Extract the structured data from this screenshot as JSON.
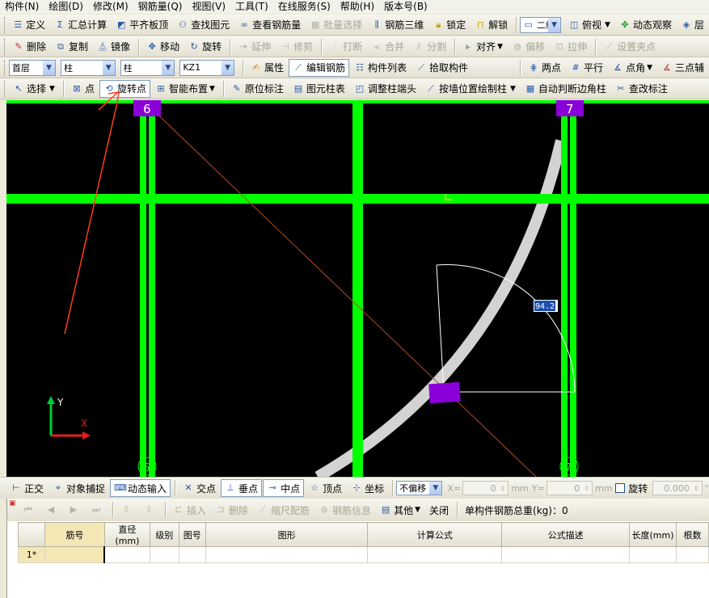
{
  "menu": [
    "构件(N)",
    "绘图(D)",
    "修改(M)",
    "钢筋量(Q)",
    "视图(V)",
    "工具(T)",
    "在线服务(S)",
    "帮助(H)",
    "版本号(B)"
  ],
  "toolbar1": {
    "define": "定义",
    "sum_calc": "汇总计算",
    "flush_slab": "平齐板顶",
    "find_element": "查找图元",
    "view_rebar_qty": "查看钢筋量",
    "batch_select": "批量选择",
    "rebar_3d": "钢筋三维",
    "lock": "锁定",
    "unlock": "解锁",
    "view_mode": "二维",
    "top_view": "俯视",
    "dynamic_observe": "动态观察",
    "layer": "层"
  },
  "toolbar2": {
    "delete": "删除",
    "copy": "复制",
    "mirror": "镜像",
    "move": "移动",
    "rotate": "旋转",
    "extend": "延伸",
    "trim": "修剪",
    "break": "打断",
    "merge": "合并",
    "split": "分割",
    "align": "对齐",
    "offset": "偏移",
    "stretch": "拉伸",
    "set_grip": "设置夹点"
  },
  "toolbar3": {
    "floor": "首层",
    "category": "柱",
    "type": "柱",
    "element": "KZ1",
    "properties": "属性",
    "edit_rebar": "编辑钢筋",
    "element_list": "构件列表",
    "pick_element": "拾取构件",
    "two_points": "两点",
    "parallel": "平行",
    "point_angle": "点角",
    "three_point_aux": "三点辅"
  },
  "toolbar4": {
    "select": "选择",
    "point": "点",
    "rotate_point": "旋转点",
    "smart_layout": "智能布置",
    "origin_label": "原位标注",
    "column_table": "图元柱表",
    "adjust_column_end": "调整柱端头",
    "draw_by_wall": "按墙位置绘制柱",
    "auto_corner": "自动判断边角柱",
    "modify_label": "查改标注"
  },
  "canvas": {
    "axis_labels": {
      "top_left": "6",
      "top_right": "7",
      "bottom_left": "6",
      "bottom_right": "7"
    },
    "angle_value": "94.2",
    "ucs": {
      "y": "Y",
      "x": "X"
    },
    "colors": {
      "grid": "#00ff00",
      "column": "#8b00d9",
      "arc": "#d3d3d3",
      "annotation": "#ff3b1f",
      "background": "#000000"
    }
  },
  "statusbar": {
    "ortho": "正交",
    "snap": "对象捕捉",
    "dynamic_input": "动态输入",
    "intersection": "交点",
    "perpendicular": "垂点",
    "midpoint": "中点",
    "vertex": "顶点",
    "coordinate": "坐标",
    "offset_mode": "不偏移",
    "x_label": "X=",
    "x_value": "0",
    "y_label": "Y=",
    "y_value": "0",
    "unit": "mm",
    "rotate_label": "旋转",
    "rotate_value": "0.000",
    "degree": "°"
  },
  "panel": {
    "insert": "插入",
    "delete": "删除",
    "scale_config": "缩尺配筋",
    "rebar_info": "钢筋信息",
    "other": "其他",
    "close": "关闭",
    "total_weight": "单构件钢筋总重(kg)：0",
    "columns": [
      "筋号",
      "直径(mm)",
      "级别",
      "图号",
      "图形",
      "计算公式",
      "公式描述",
      "长度(mm)",
      "根数"
    ],
    "row_label": "1*"
  }
}
